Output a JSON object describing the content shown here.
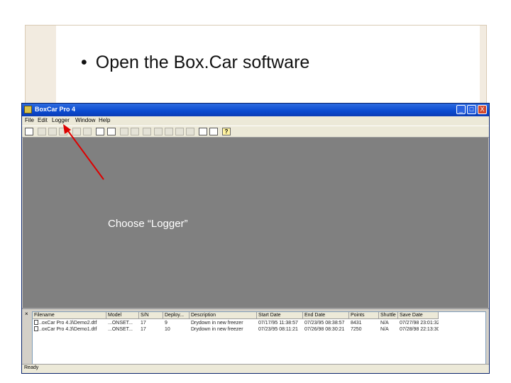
{
  "slide": {
    "bullet_text": "Open the Box.Car software"
  },
  "window": {
    "title": "BoxCar Pro 4",
    "buttons": [
      "_",
      "□",
      "X"
    ]
  },
  "menu": [
    {
      "label": "File"
    },
    {
      "label": "Edit"
    },
    {
      "label": "Logger"
    },
    {
      "label": "Window"
    },
    {
      "label": "Help"
    }
  ],
  "toolbar": {
    "tools": [
      {
        "icon": "open-icon",
        "state": "on"
      },
      {
        "icon": "logger-icon-1",
        "state": "off"
      },
      {
        "icon": "logger-icon-2",
        "state": "off"
      },
      {
        "icon": "logger-icon-3",
        "state": "off"
      },
      {
        "icon": "copy-icon",
        "state": "off"
      },
      {
        "icon": "print-icon",
        "state": "off"
      },
      {
        "icon": "launch-icon",
        "state": "on"
      },
      {
        "icon": "readout-icon",
        "state": "on"
      },
      {
        "icon": "zoom-in-icon",
        "state": "off"
      },
      {
        "icon": "zoom-out-icon",
        "state": "off"
      },
      {
        "icon": "add-icon",
        "state": "off"
      },
      {
        "icon": "select-icon",
        "state": "off"
      },
      {
        "icon": "zoom-icon",
        "state": "off"
      },
      {
        "icon": "refresh-icon",
        "state": "off"
      },
      {
        "icon": "blank-icon",
        "state": "off"
      },
      {
        "icon": "chart-icon",
        "state": "on"
      },
      {
        "icon": "table-icon",
        "state": "on"
      },
      {
        "icon": "help-icon",
        "state": "on",
        "glyph": "?"
      }
    ]
  },
  "overlay_text": "Choose “Logger”",
  "list": {
    "columns": [
      "Filename",
      "Model",
      "S/N",
      "Deploy...",
      "Description",
      "Start Date",
      "End Date",
      "Points",
      "Shuttle ...",
      "Save Date"
    ],
    "rows": [
      [
        "..oxCar Pro 4.3\\Demo2.dtf",
        "...ONSET...",
        "17",
        "9",
        "Drydown in new freezer",
        "07/17/95 11:38:57",
        "07/23/95 08:38:57",
        "8431",
        "N/A",
        "07/27/98 23:01:32"
      ],
      [
        "..oxCar Pro 4.3\\Demo1.dtf",
        "...ONSET...",
        "17",
        "10",
        "Drydown in new freezer",
        "07/23/95 08:11:21",
        "07/26/98 08:30:21",
        "7250",
        "N/A",
        "07/28/98 22:13:30"
      ]
    ]
  },
  "status": "Ready",
  "colors": {
    "arrow": "#dd0000",
    "workspace": "#808080",
    "titlebar": "#0a4ad0"
  }
}
